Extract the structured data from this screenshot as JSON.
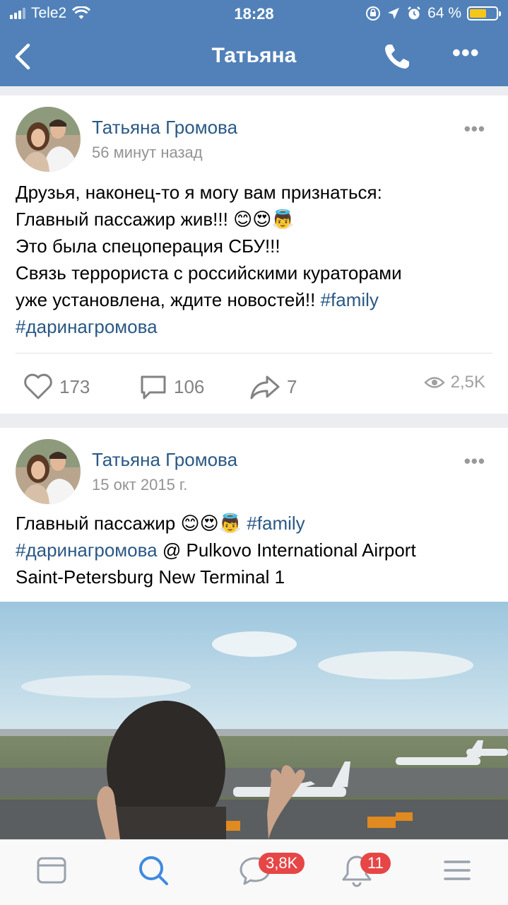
{
  "status_bar": {
    "carrier": "Tele2",
    "time": "18:28",
    "battery_percent": "64 %",
    "battery_level": 0.64,
    "icons": [
      "signal-icon",
      "wifi-icon",
      "lock-rotation-icon",
      "location-icon",
      "alarm-icon",
      "battery-icon"
    ]
  },
  "nav": {
    "title": "Татьяна",
    "back_icon": "chevron-left-icon",
    "call_icon": "phone-icon",
    "more_label": "•••"
  },
  "posts": [
    {
      "author": "Татьяна Громова",
      "time": "56 минут назад",
      "more_label": "•••",
      "text_lines": [
        "Друзья, наконец-то я могу вам признаться:",
        "Главный пассажир жив!!!",
        "Это была спецоперация СБУ!!!",
        "Связь террориста с российскими кураторами",
        "уже установлена, ждите новостей!!"
      ],
      "emojis": [
        "😊",
        "😍",
        "👼"
      ],
      "hashtags": [
        "#family",
        "#даринагромова"
      ],
      "likes": "173",
      "comments": "106",
      "shares": "7",
      "views": "2,5K"
    },
    {
      "author": "Татьяна Громова",
      "time": "15 окт 2015 г.",
      "more_label": "•••",
      "text_start": "Главный пассажир",
      "emojis": [
        "😊",
        "😍",
        "👼"
      ],
      "hashtags": [
        "#family",
        "#даринагромова"
      ],
      "location": "@ Pulkovo International Airport",
      "location_line2": "Saint-Petersburg New Terminal 1"
    }
  ],
  "tab_bar": {
    "tabs": [
      "news-icon",
      "search-icon",
      "messages-icon",
      "notifications-icon",
      "menu-icon"
    ],
    "messages_badge": "3,8K",
    "notifications_badge": "11",
    "active_tab": "search-icon"
  },
  "colors": {
    "header": "#5181b8",
    "link": "#2a5885",
    "badge": "#e64646",
    "active_tab": "#3f8ae0"
  }
}
